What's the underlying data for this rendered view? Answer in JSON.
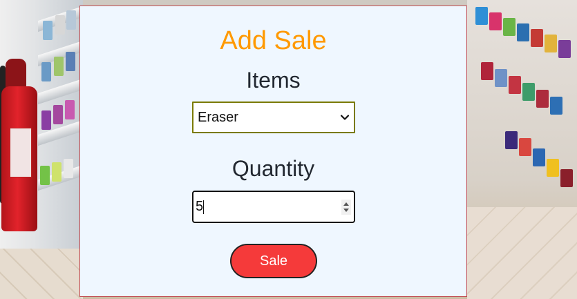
{
  "form": {
    "title": "Add Sale",
    "items_label": "Items",
    "selected_item": "Eraser",
    "quantity_label": "Quantity",
    "quantity_value": "5",
    "submit_label": "Sale"
  },
  "colors": {
    "title": "#ff9900",
    "panel_bg": "#eff7ff",
    "button_bg": "#f53a3a",
    "select_border": "#7a7a00"
  },
  "icons": {
    "select_arrow": "chevron-down-icon",
    "number_spinner": "spinner-arrows-icon"
  }
}
